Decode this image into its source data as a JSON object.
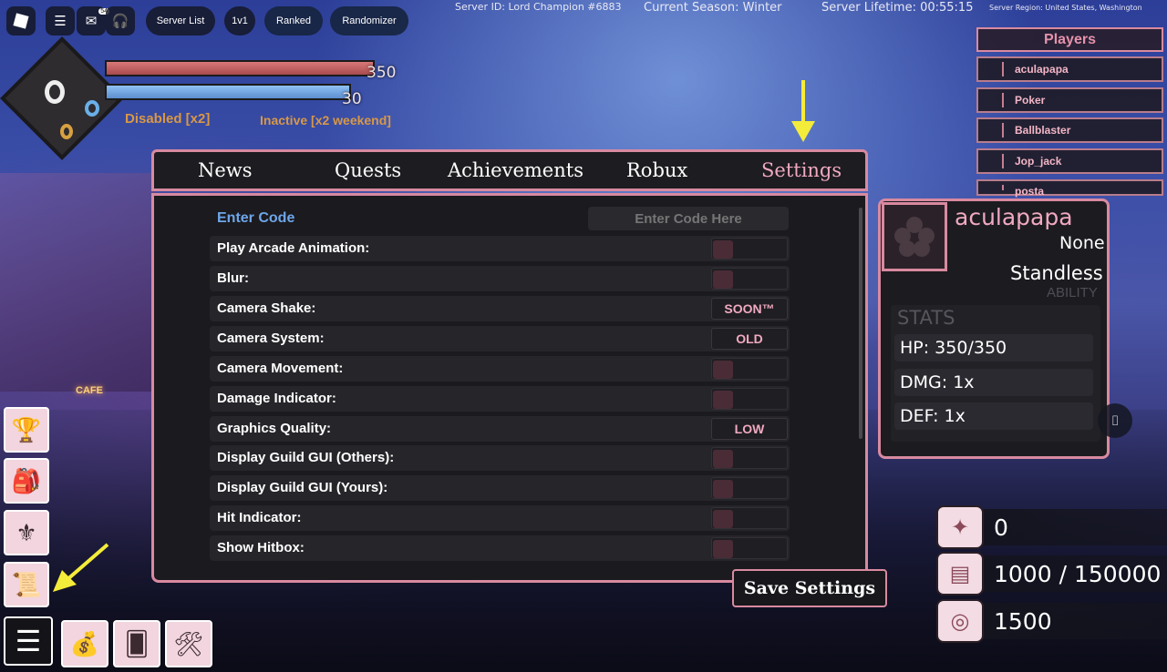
{
  "topbar": {
    "notif_count": "54",
    "buttons": [
      "Server List",
      "1v1",
      "Ranked",
      "Randomizer"
    ],
    "server_id": "Server ID: Lord Champion #6883",
    "season": "Current Season: Winter",
    "lifetime": "Server Lifetime: 00:55:15",
    "region": "Server Region: United States, Washington"
  },
  "hud": {
    "hp_value": "350",
    "mana_value": "30",
    "status_left": "Disabled [x2]",
    "status_right": "Inactive [x2 weekend]"
  },
  "players": {
    "title": "Players",
    "list": [
      "aculapapa",
      "Poker",
      "Ballblaster",
      "Jop_jack",
      "posta"
    ]
  },
  "tabs": [
    "News",
    "Quests",
    "Achievements",
    "Robux",
    "Settings"
  ],
  "settings": {
    "code_label": "Enter Code",
    "code_placeholder": "Enter Code Here",
    "rows": [
      {
        "label": "Play Arcade Animation:",
        "type": "toggle"
      },
      {
        "label": "Blur:",
        "type": "toggle"
      },
      {
        "label": "Camera Shake:",
        "type": "button",
        "value": "SOON™"
      },
      {
        "label": "Camera System:",
        "type": "button",
        "value": "OLD"
      },
      {
        "label": "Camera Movement:",
        "type": "toggle"
      },
      {
        "label": "Damage Indicator:",
        "type": "toggle"
      },
      {
        "label": "Graphics Quality:",
        "type": "button",
        "value": "LOW"
      },
      {
        "label": "Display Guild GUI (Others):",
        "type": "toggle"
      },
      {
        "label": "Display Guild GUI (Yours):",
        "type": "toggle"
      },
      {
        "label": "Hit Indicator:",
        "type": "toggle"
      },
      {
        "label": "Show Hitbox:",
        "type": "toggle"
      }
    ],
    "save_label": "Save Settings"
  },
  "profile": {
    "username": "aculapapa",
    "title": "None",
    "ability": "Standless",
    "ability_label": "ABILITY",
    "stats_label": "STATS",
    "stats": [
      "HP: 350/350",
      "DMG: 1x",
      "DEF: 1x"
    ]
  },
  "currency": [
    "0",
    "1000 / 150000",
    "1500"
  ],
  "colors": {
    "accent": "#d88aa0",
    "toggle_off": "#4a2c36",
    "option_text": "#f0a9c0",
    "status": "#d89846"
  }
}
